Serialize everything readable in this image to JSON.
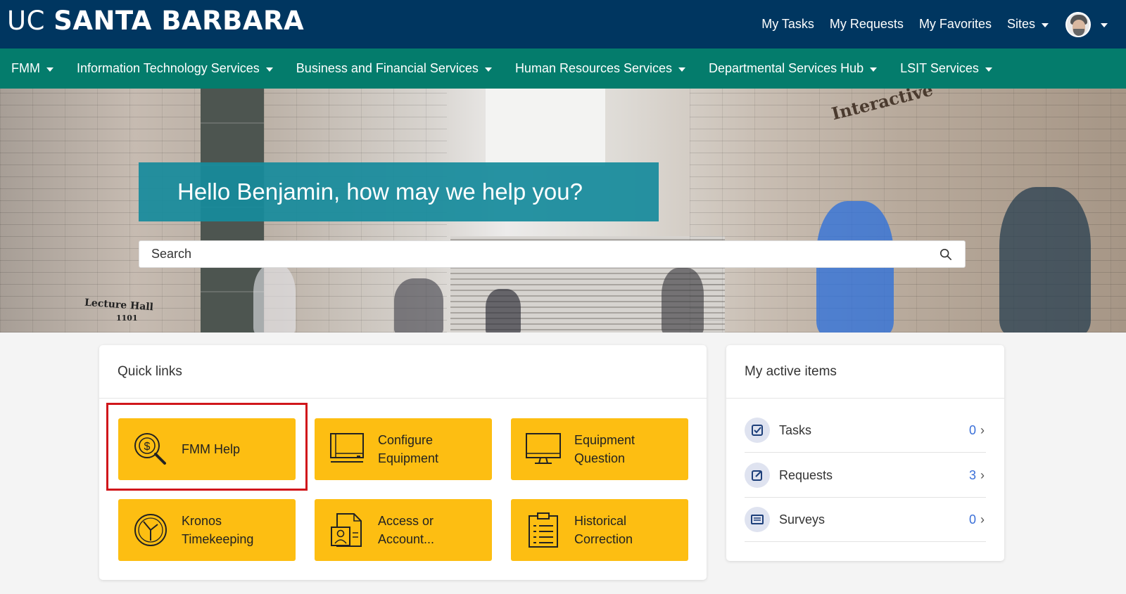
{
  "header": {
    "logo_uc": "UC",
    "logo_sb": "SANTA BARBARA",
    "links": [
      "My Tasks",
      "My Requests",
      "My Favorites"
    ],
    "sites_label": "Sites"
  },
  "nav": {
    "items": [
      "FMM",
      "Information Technology Services",
      "Business and Financial Services",
      "Human Resources Services",
      "Departmental Services Hub",
      "LSIT Services"
    ]
  },
  "hero": {
    "greeting": "Hello Benjamin, how may we help you?",
    "search_placeholder": "Search",
    "sign_interactive": "Interactive",
    "sign_lecture": "Lecture Hall",
    "sign_number": "1101"
  },
  "quick_links": {
    "title": "Quick links",
    "tiles": [
      {
        "label": "FMM Help",
        "icon": "dollar-magnifier-icon"
      },
      {
        "label": "Configure Equipment",
        "icon": "monitor-icon"
      },
      {
        "label": "Equipment Question",
        "icon": "monitor-icon"
      },
      {
        "label": "Kronos Timekeeping",
        "icon": "clock-icon"
      },
      {
        "label": "Access or Account...",
        "icon": "id-document-icon"
      },
      {
        "label": "Historical Correction",
        "icon": "clipboard-list-icon"
      }
    ]
  },
  "active_items": {
    "title": "My active items",
    "rows": [
      {
        "label": "Tasks",
        "count": "0",
        "icon": "checkbox-icon"
      },
      {
        "label": "Requests",
        "count": "3",
        "icon": "edit-icon"
      },
      {
        "label": "Surveys",
        "count": "0",
        "icon": "survey-icon"
      }
    ]
  },
  "colors": {
    "header": "#003660",
    "nav": "#047c6c",
    "tile": "#fdbe12",
    "greeting_bg": "#178b9c",
    "highlight": "#d0161b",
    "count": "#3a6fd8"
  }
}
